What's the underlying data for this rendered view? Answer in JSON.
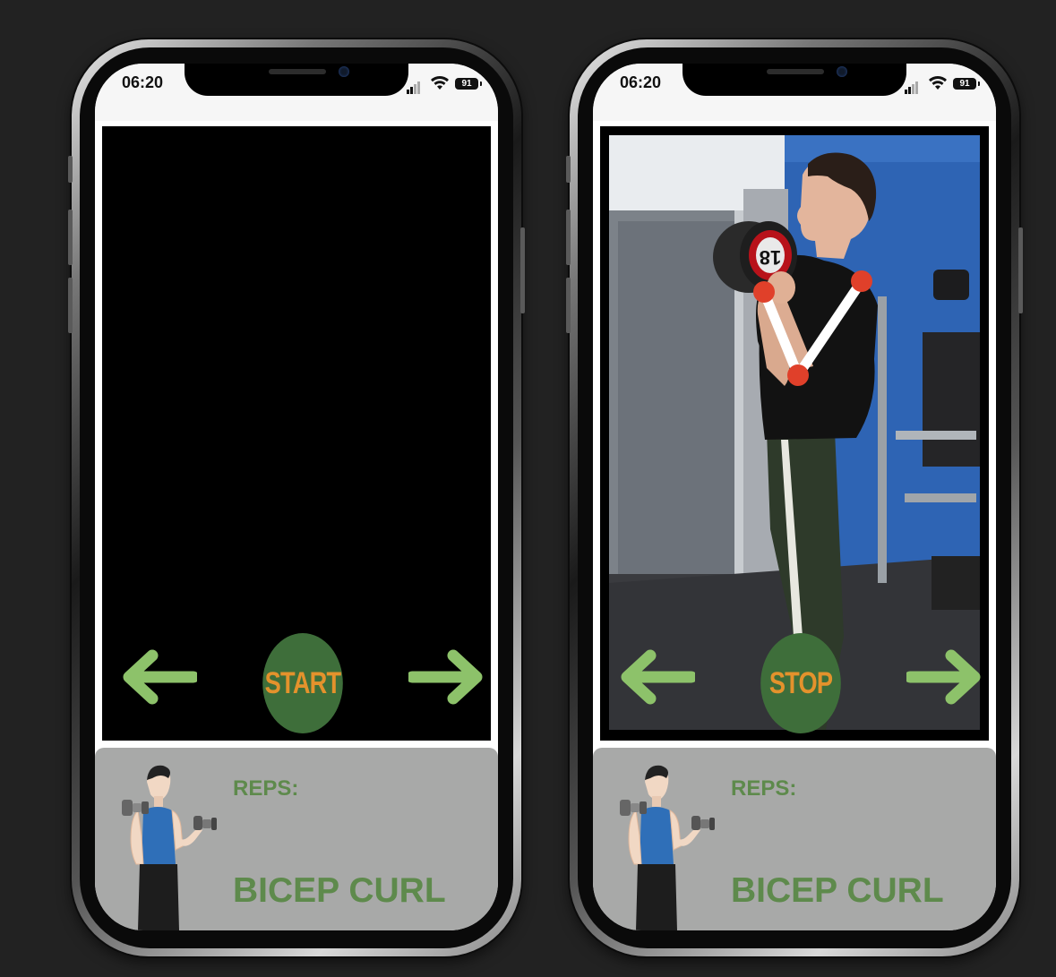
{
  "phones": [
    {
      "status_bar": {
        "time": "06:20",
        "battery": "91"
      },
      "camera": {
        "state": "inactive"
      },
      "nav": {
        "prev_icon": "arrow-left-icon",
        "next_icon": "arrow-right-icon"
      },
      "action_button": {
        "label": "START"
      },
      "panel": {
        "reps_label": "REPS:",
        "exercise_name": "BICEP CURL"
      }
    },
    {
      "status_bar": {
        "time": "06:20",
        "battery": "91"
      },
      "camera": {
        "state": "tracking",
        "photo_weight_label": "18",
        "pose_joints": [
          "wrist",
          "elbow",
          "shoulder"
        ]
      },
      "nav": {
        "prev_icon": "arrow-left-icon",
        "next_icon": "arrow-right-icon"
      },
      "action_button": {
        "label": "STOP"
      },
      "panel": {
        "reps_label": "REPS:",
        "exercise_name": "BICEP CURL"
      }
    }
  ],
  "colors": {
    "background": "#222222",
    "button_green": "#3e6e3a",
    "button_text": "#e4922c",
    "arrow_green": "#8dc26a",
    "panel_gray": "#a8a9a8",
    "panel_text": "#5e8a4c",
    "joint_red": "#e0402a"
  }
}
